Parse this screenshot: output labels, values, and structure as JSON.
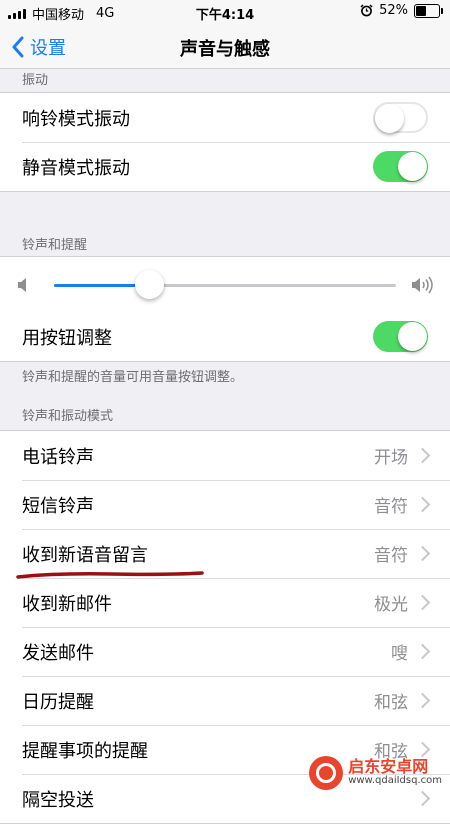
{
  "status": {
    "carrier": "中国移动",
    "network": "4G",
    "time": "下午4:14",
    "battery": "52%",
    "battery_level": 0.52
  },
  "nav": {
    "back_label": "设置",
    "title": "声音与触感"
  },
  "vibration": {
    "header": "振动",
    "items": [
      {
        "label": "响铃模式振动",
        "on": false
      },
      {
        "label": "静音模式振动",
        "on": true
      }
    ]
  },
  "ringer": {
    "header": "铃声和提醒",
    "volume_level": 0.28,
    "button_label": "用按钮调整",
    "button_on": true,
    "footer": "铃声和提醒的音量可用音量按钮调整。"
  },
  "patterns": {
    "header": "铃声和振动模式",
    "items": [
      {
        "label": "电话铃声",
        "value": "开场"
      },
      {
        "label": "短信铃声",
        "value": "音符"
      },
      {
        "label": "收到新语音留言",
        "value": "音符"
      },
      {
        "label": "收到新邮件",
        "value": "极光"
      },
      {
        "label": "发送邮件",
        "value": "嗖"
      },
      {
        "label": "日历提醒",
        "value": "和弦"
      },
      {
        "label": "提醒事项的提醒",
        "value": "和弦"
      },
      {
        "label": "隔空投送",
        "value": ""
      }
    ]
  },
  "watermark": {
    "name": "启东安卓网",
    "url": "www.qdaiIdsq.com"
  }
}
